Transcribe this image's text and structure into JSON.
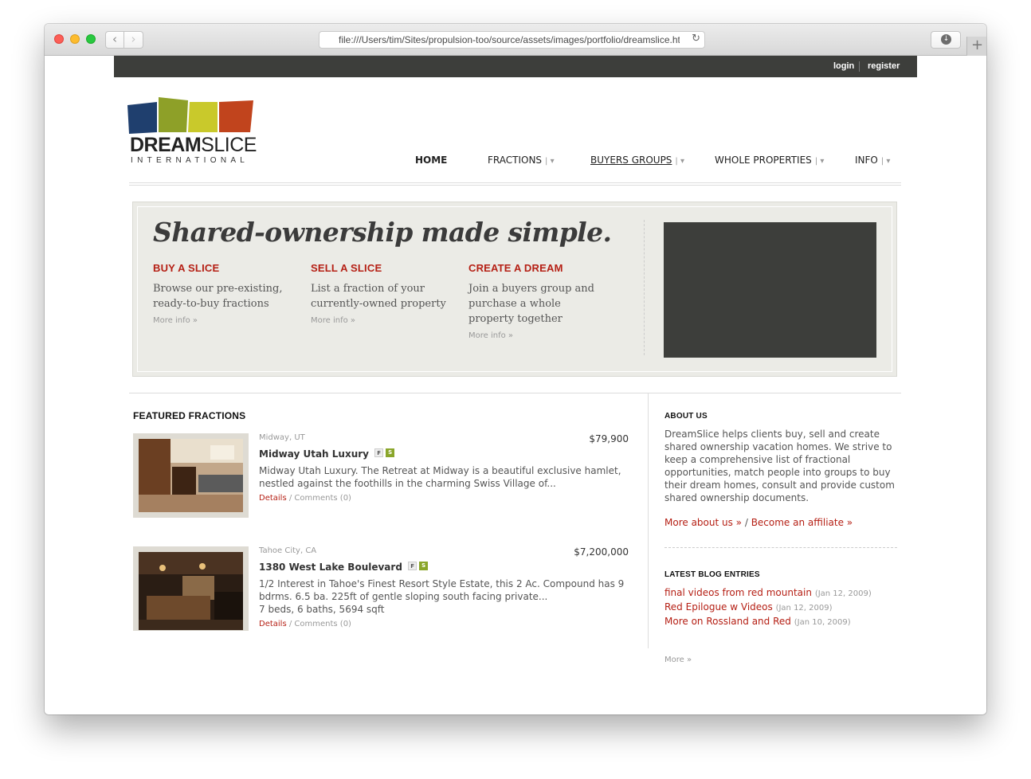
{
  "browser": {
    "url": "file:///Users/tim/Sites/propulsion-too/source/assets/images/portfolio/dreamslice.html"
  },
  "topbar": {
    "login": "login",
    "register": "register"
  },
  "logo": {
    "word_bold": "DREAM",
    "word_light": "SLICE",
    "sub": "INTERNATIONAL"
  },
  "nav": [
    {
      "label": "HOME"
    },
    {
      "label": "FRACTIONS"
    },
    {
      "label": "BUYERS GROUPS"
    },
    {
      "label": "WHOLE PROPERTIES"
    },
    {
      "label": "INFO"
    }
  ],
  "hero": {
    "title": "Shared-ownership made simple.",
    "columns": [
      {
        "heading": "BUY A SLICE",
        "desc": "Browse our pre-existing, ready-to-buy fractions",
        "more": "More info »"
      },
      {
        "heading": "SELL A SLICE",
        "desc": "List a fraction of your currently-owned property",
        "more": "More info »"
      },
      {
        "heading": "CREATE A DREAM",
        "desc": "Join a buyers group and purchase a whole property together",
        "more": "More info »"
      }
    ]
  },
  "featured": {
    "title": "FEATURED FRACTIONS",
    "listings": [
      {
        "location": "Midway, UT",
        "price": "$79,900",
        "title": "Midway Utah Luxury",
        "badge_f": "F",
        "badge_s": "S",
        "desc": "Midway Utah Luxury. The Retreat at Midway is a beautiful exclusive hamlet, nestled against the foothills in the charming Swiss Village of...",
        "details": "Details",
        "comments": "Comments (0)"
      },
      {
        "location": "Tahoe City, CA",
        "price": "$7,200,000",
        "title": "1380 West Lake Boulevard",
        "badge_f": "F",
        "badge_s": "S",
        "desc": "1/2 Interest in Tahoe's Finest Resort Style Estate, this 2 Ac. Compound has 9 bdrms. 6.5 ba. 225ft of gentle sloping south facing private...",
        "specs": "7 beds, 6 baths, 5694 sqft",
        "details": "Details",
        "comments": "Comments (0)"
      }
    ]
  },
  "sidebar": {
    "about_title": "ABOUT US",
    "about_body": "DreamSlice helps clients buy, sell and create shared ownership vacation homes. We strive to keep a comprehensive list of fractional opportunities, match people into groups to buy their dream homes, consult and provide custom shared ownership documents.",
    "more_about": "More about us »",
    "affiliate": "Become an affiliate »",
    "blog_title": "LATEST BLOG ENTRIES",
    "blog": [
      {
        "title": "final videos from red mountain",
        "date": "(Jan 12, 2009)"
      },
      {
        "title": "Red Epilogue w Videos",
        "date": "(Jan 12, 2009)"
      },
      {
        "title": "More on Rossland and Red",
        "date": "(Jan 10, 2009)"
      }
    ],
    "blog_more": "More »"
  },
  "colors": {
    "accent": "#b51f14",
    "dark_bar": "#3d3e3b",
    "hero_bg": "#ebebe6",
    "badge_green": "#8aa62b"
  }
}
